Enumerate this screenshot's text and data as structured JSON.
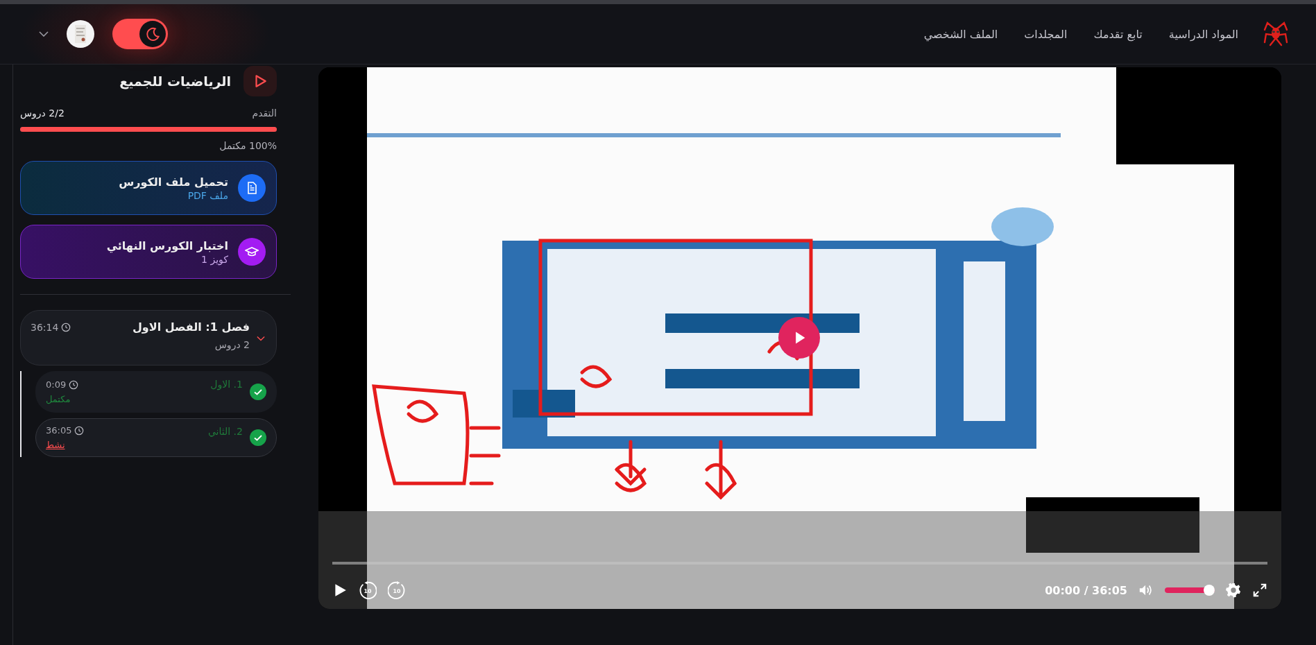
{
  "header": {
    "nav": [
      {
        "label": "المواد الدراسية",
        "selected": false
      },
      {
        "label": "تابع تقدمك",
        "selected": false
      },
      {
        "label": "المجلدات",
        "selected": false
      },
      {
        "label": "الملف الشخصي",
        "selected": false
      }
    ],
    "dark_mode": {
      "on": true
    }
  },
  "sidebar": {
    "course_title": "الرياضيات للجميع",
    "progress": {
      "label": "التقدم",
      "count": "2/2 دروس",
      "level": 1,
      "percent": "100% مكتمل"
    },
    "cards": [
      {
        "kind": "file",
        "title": "تحميل ملف الكورس",
        "subtitle": "ملف PDF"
      },
      {
        "kind": "quiz",
        "title": "اختبار الكورس النهائي",
        "subtitle": "كويز 1"
      }
    ],
    "chapters": [
      {
        "title": "فصل 1: الفصل الاول",
        "lessons_count": "2 دروس",
        "duration": "36:14",
        "expanded": true,
        "lessons": [
          {
            "title": "1. الاول",
            "duration": "0:09",
            "status": "مكتمل",
            "color": "#1f8a3e",
            "checked": true,
            "selected": false
          },
          {
            "title": "2. الثاني",
            "duration": "36:05",
            "status": "نشط",
            "color": "#ff4d4f",
            "checked": true,
            "selected": true
          }
        ]
      }
    ]
  },
  "player": {
    "progress": {
      "level": 0
    },
    "rewind_label": "10",
    "forward_label": "10",
    "time": "00:00 / 36:05",
    "volume": {
      "level": 1
    },
    "playing": false
  }
}
